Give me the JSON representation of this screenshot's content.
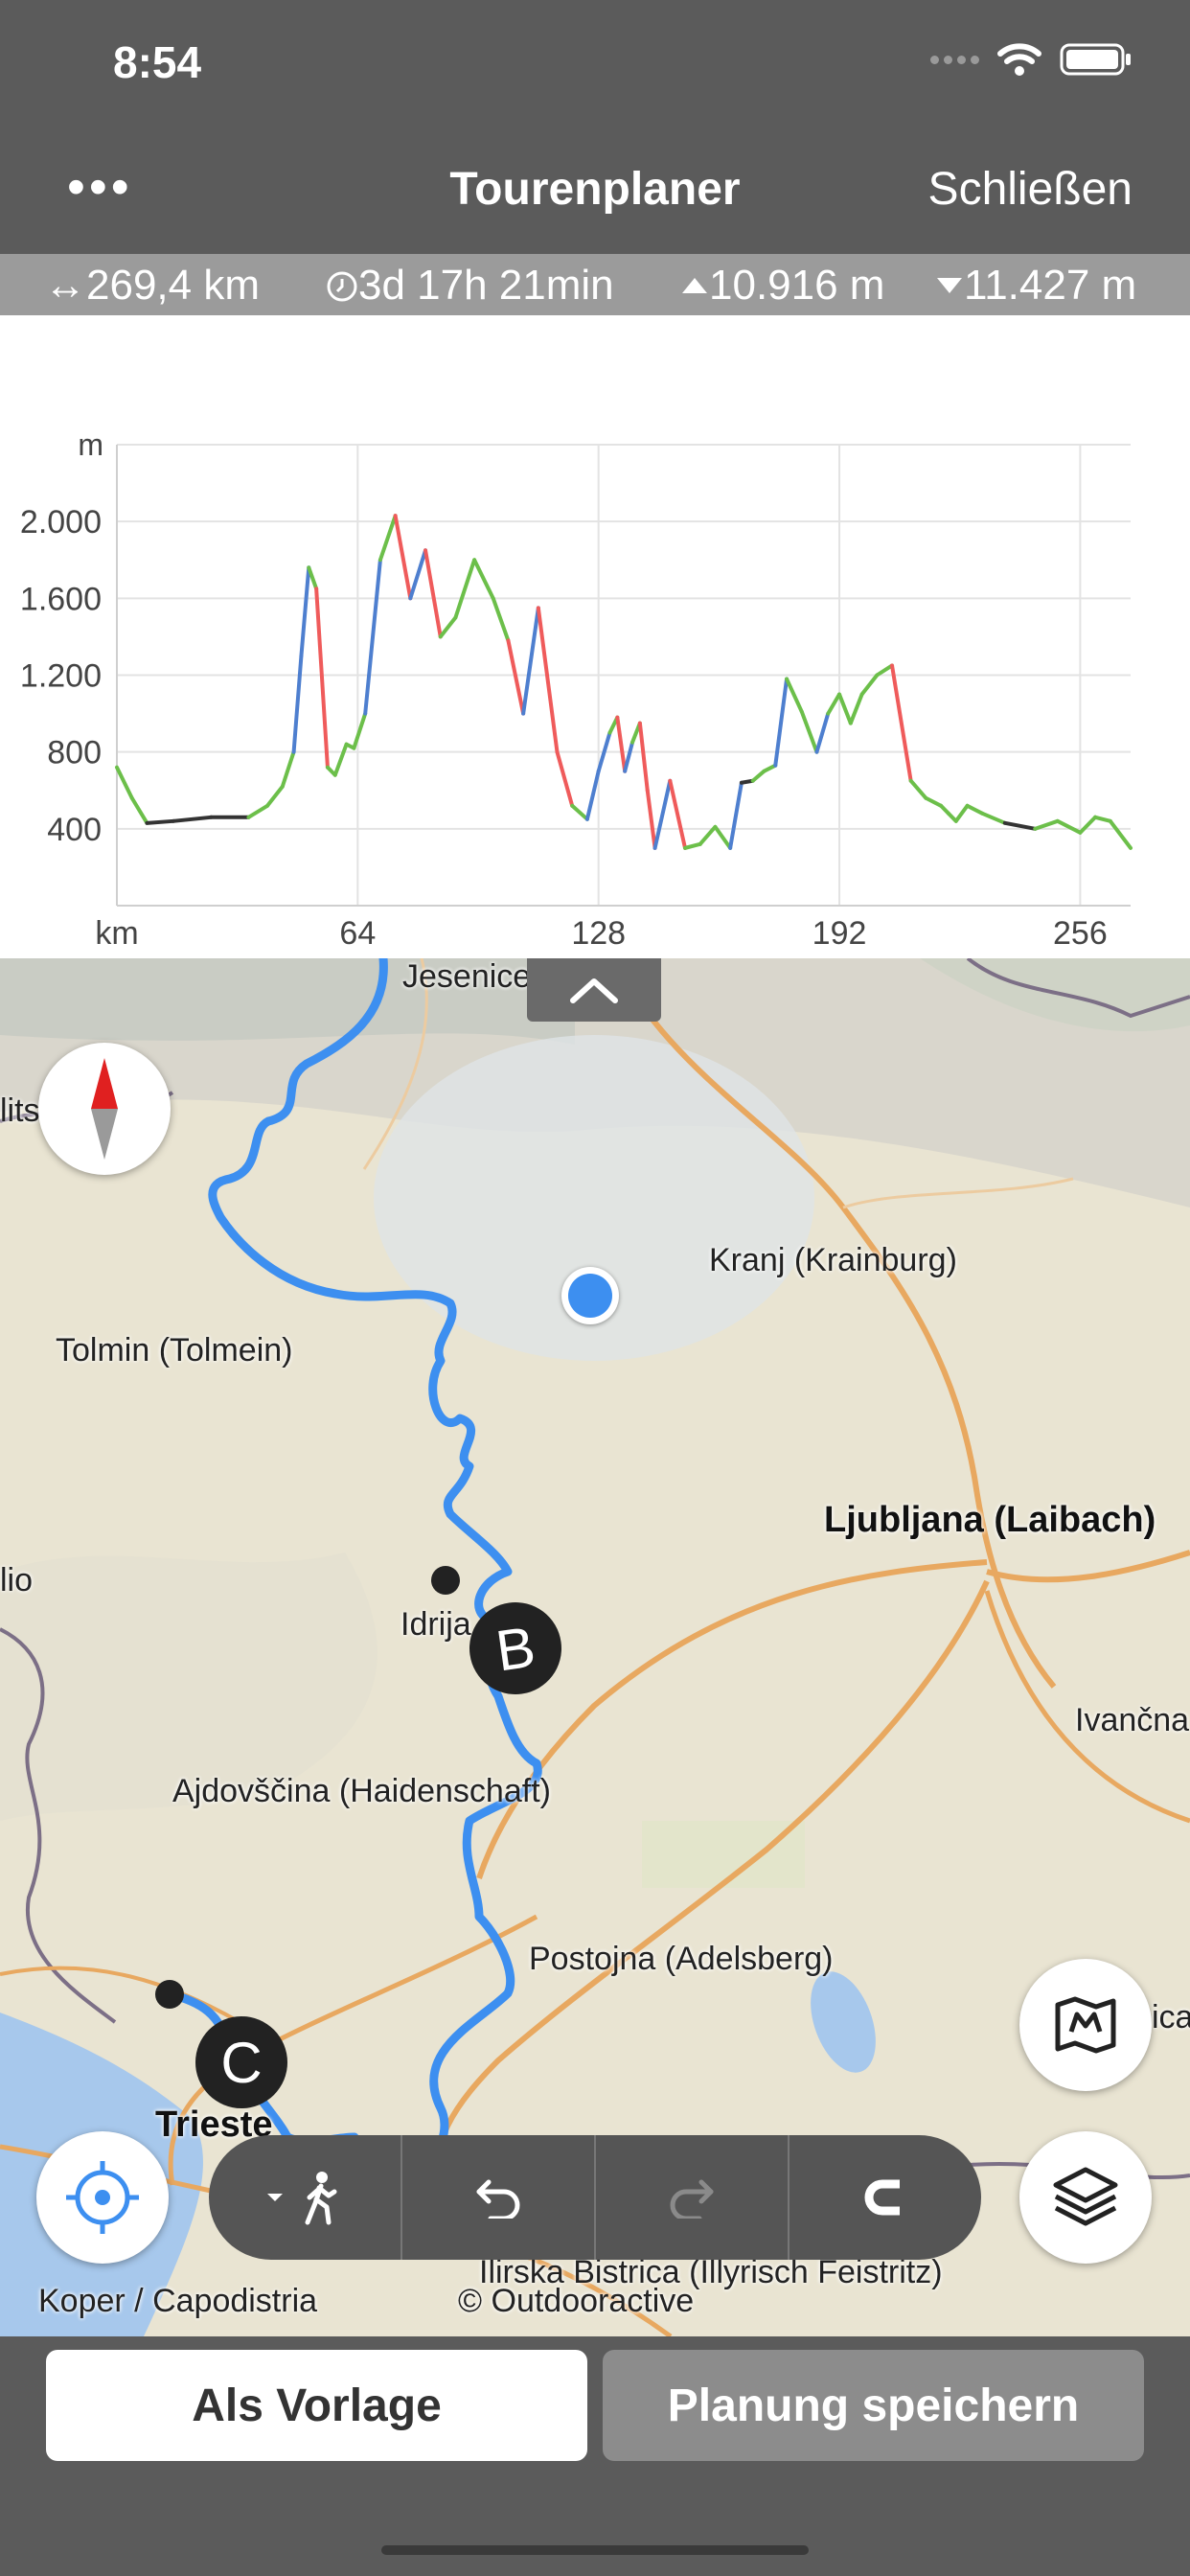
{
  "status": {
    "time": "8:54"
  },
  "nav": {
    "more": "•••",
    "title": "Tourenplaner",
    "close": "Schließen"
  },
  "stats": {
    "distance": "↔269,4 km",
    "duration": "3d 17h 21min",
    "ascent": "10.916 m",
    "descent": "11.427 m"
  },
  "chart_data": {
    "type": "line",
    "ylabel": "m",
    "xlabel": "km",
    "yticks": [
      "2.000",
      "1.600",
      "1.200",
      "800",
      "400"
    ],
    "xticks": [
      "64",
      "128",
      "192",
      "256"
    ],
    "xlim": [
      0,
      269.4
    ],
    "ylim": [
      0,
      2400
    ],
    "x": [
      0,
      4,
      8,
      15,
      25,
      35,
      40,
      44,
      47,
      49,
      51,
      53,
      56,
      58,
      61,
      63,
      66,
      70,
      74,
      78,
      82,
      86,
      90,
      95,
      100,
      104,
      108,
      112,
      117,
      121,
      125,
      128,
      131,
      133,
      135,
      137,
      139,
      141,
      143,
      147,
      151,
      155,
      159,
      163,
      166,
      169,
      172,
      175,
      178,
      182,
      186,
      189,
      192,
      195,
      198,
      202,
      206,
      211,
      215,
      219,
      221,
      223,
      226,
      230,
      236,
      244,
      250,
      256,
      260,
      264,
      269.4
    ],
    "y": [
      720,
      560,
      430,
      440,
      460,
      460,
      520,
      620,
      800,
      1300,
      1760,
      1650,
      720,
      680,
      840,
      820,
      1000,
      1800,
      2030,
      1600,
      1850,
      1400,
      1500,
      1800,
      1600,
      1380,
      1000,
      1550,
      800,
      520,
      450,
      700,
      900,
      980,
      700,
      850,
      950,
      600,
      300,
      650,
      300,
      320,
      410,
      300,
      640,
      650,
      700,
      730,
      1180,
      1010,
      800,
      1000,
      1100,
      950,
      1100,
      1200,
      1250,
      650,
      560,
      520,
      480,
      440,
      520,
      480,
      430,
      400,
      440,
      380,
      460,
      440,
      300
    ]
  },
  "map": {
    "labels": {
      "jesenice": "Jesenice",
      "lits": "lits",
      "kranj": "Kranj (Krainburg)",
      "tolmin": "Tolmin (Tolmein)",
      "ljubljana": "Ljubljana (Laibach)",
      "lio": "lio",
      "idrija": "Idrija",
      "ivancna": "Ivančna",
      "ajdovscina": "Ajdovščina (Haidenschaft)",
      "postojna": "Postojna (Adelsberg)",
      "trieste": "Trieste",
      "ica": "ica",
      "koper": "Koper / Capodistria",
      "bistrica": "Ilirska Bistrica (Illyrisch Feistritz)",
      "copyright": "© Outdooractive"
    },
    "markers": {
      "b": "B",
      "c": "C"
    }
  },
  "colors": {
    "route": "#3d8ff0",
    "location": "#3d8ff0",
    "water": "#a7c8ec",
    "roads": "#e8a860"
  },
  "bottom": {
    "template_label": "Als Vorlage",
    "save_label": "Planung speichern"
  }
}
